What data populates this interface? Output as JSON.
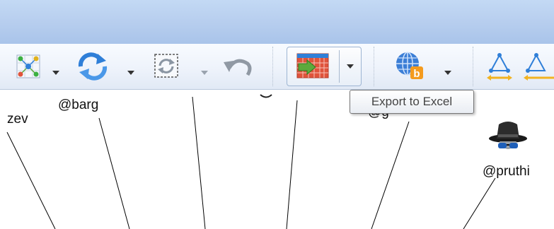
{
  "toolbar": {
    "tools": [
      {
        "name": "layout",
        "icon": "graph-layout-icon"
      },
      {
        "name": "refresh",
        "icon": "refresh-arrows-icon"
      },
      {
        "name": "dynamic-filter",
        "icon": "dashed-refresh-icon"
      },
      {
        "name": "undo",
        "icon": "undo-arrow-icon"
      },
      {
        "name": "export-excel",
        "icon": "excel-export-icon"
      },
      {
        "name": "web-bing",
        "icon": "globe-bing-icon"
      },
      {
        "name": "graph-metrics",
        "icon": "triangle-network-icon"
      }
    ]
  },
  "tooltip": {
    "text": "Export to Excel"
  },
  "graph": {
    "labels": [
      {
        "id": "vertex-left",
        "text": "zev"
      },
      {
        "id": "vertex-barg",
        "text": "@barg"
      },
      {
        "id": "vertex-green",
        "text": "@g"
      },
      {
        "id": "vertex-pruthi",
        "text": "@pruthi"
      }
    ],
    "avatar_icon": "spy-hat-glasses-icon"
  },
  "colors": {
    "titlebar": "#b6cdee",
    "toolbar": "#eef3fb",
    "accent_blue": "#2f7fd8",
    "excel_green": "#5caa3c",
    "excel_red": "#e0543c",
    "bing_orange": "#f49b1e",
    "arrow_yellow": "#f2b321"
  }
}
